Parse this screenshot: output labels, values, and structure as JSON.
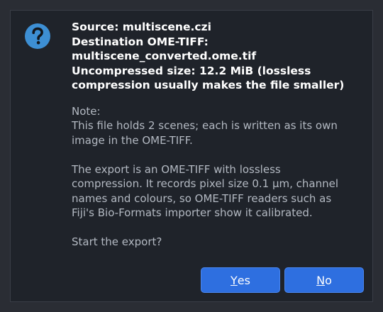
{
  "dialog": {
    "icon": "question-icon",
    "headline": [
      "Source: multiscene.czi",
      "Destination OME-TIFF:",
      "multiscene_converted.ome.tif",
      "Uncompressed size: 12.2 MiB (lossless",
      "compression usually makes the file smaller)"
    ],
    "note_lines": [
      "Note:",
      "This file holds 2 scenes; each is written as its own",
      "image in the OME-TIFF.",
      "",
      "The export is an OME-TIFF with lossless",
      "compression. It records pixel size 0.1 µm, channel",
      "names and colours, so OME-TIFF readers such as",
      "Fiji's Bio-Formats importer show it calibrated.",
      "",
      "Start the export?"
    ],
    "buttons": {
      "yes": {
        "mnemonic": "Y",
        "rest": "es"
      },
      "no": {
        "mnemonic": "N",
        "rest": "o"
      }
    },
    "colors": {
      "icon_bg": "#3d8fd4",
      "button_bg": "#2e6fe0",
      "dialog_bg": "#1f232a"
    }
  }
}
